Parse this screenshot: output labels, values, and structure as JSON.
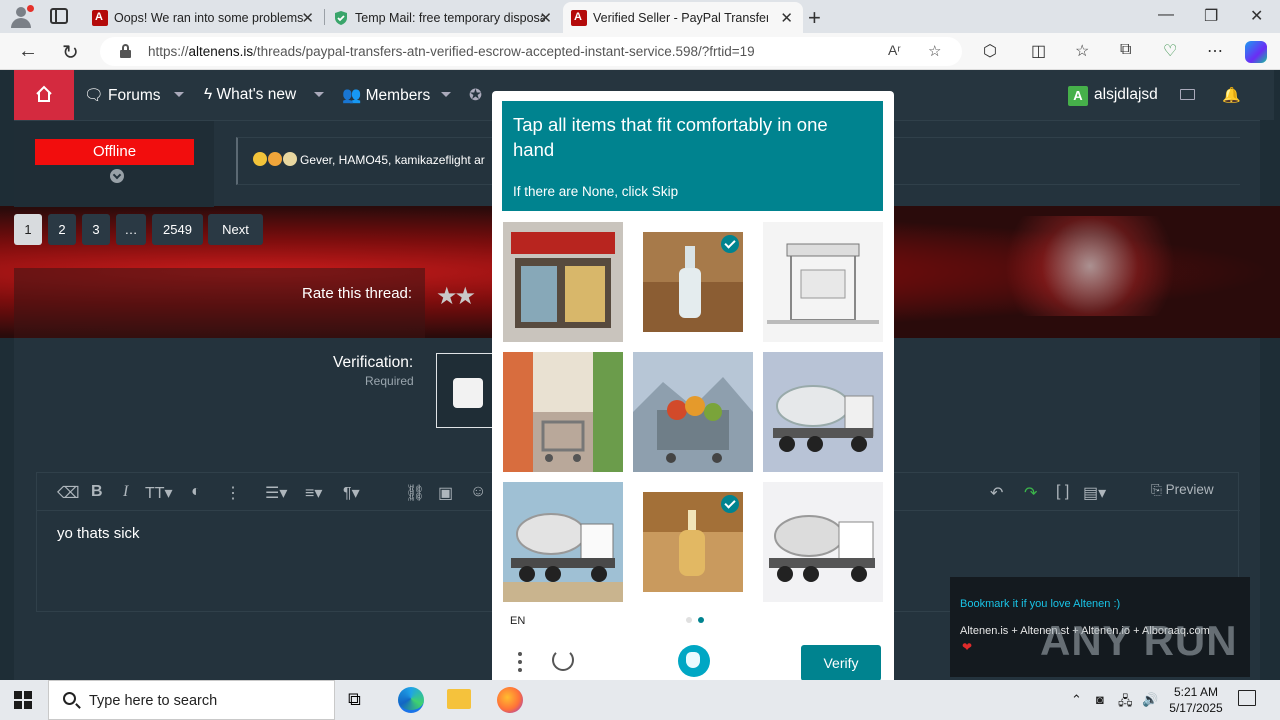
{
  "browser": {
    "tabs": [
      {
        "title": "Oops! We ran into some problems",
        "favicon": "altenen-icon"
      },
      {
        "title": "Temp Mail: free temporary disposable",
        "favicon": "shield-icon"
      },
      {
        "title": "Verified Seller - PayPal Transfers - ",
        "favicon": "altenen-icon",
        "active": true
      }
    ],
    "url_prefix": "https://",
    "url_host": "altenens.is",
    "url_path": "/threads/paypal-transfers-atn-verified-escrow-accepted-instant-service.598/?frtid=19"
  },
  "forum": {
    "nav": {
      "forums": "Forums",
      "whats_new": "What's new",
      "members": "Members",
      "username": "alsjdlajsd",
      "user_initial": "A"
    },
    "post": {
      "status": "Offline",
      "reactors": "Gever, HAMO45, kamikazeflight ar"
    },
    "pagination": [
      "1",
      "2",
      "3",
      "…",
      "2549",
      "Next"
    ],
    "rate_label": "Rate this thread:",
    "verification_label": "Verification:",
    "verification_required": "Required",
    "editor_text": "yo thats sick",
    "preview_label": "Preview",
    "bookmark_title": "Bookmark it if you love Altenen :)",
    "bookmark_sites": "Altenen.is + Altenen.st + Altenen.io + Alboraaq.com",
    "watermark": "ANY RUN"
  },
  "captcha": {
    "prompt": "Tap all items that fit comfortably in one hand",
    "sub": "If there are None, click Skip",
    "images": [
      {
        "label": "",
        "subject": "store-front",
        "selected": false
      },
      {
        "label": "",
        "subject": "glass-bottle",
        "selected": true
      },
      {
        "label": "",
        "subject": "kiosk-sketch",
        "selected": false
      },
      {
        "label": "",
        "subject": "shopping-cart-aisle",
        "selected": false
      },
      {
        "label": "",
        "subject": "shopping-cart-fruit",
        "selected": false
      },
      {
        "label": "",
        "subject": "cement-truck",
        "selected": false
      },
      {
        "label": "",
        "subject": "cement-truck",
        "selected": false
      },
      {
        "label": "",
        "subject": "oil-bottle",
        "selected": true
      },
      {
        "label": "",
        "subject": "cement-truck",
        "selected": false
      }
    ],
    "language": "EN",
    "verify_label": "Verify",
    "accent": "#00838f"
  },
  "taskbar": {
    "search_placeholder": "Type here to search",
    "time": "5:21 AM",
    "date": "5/17/2025"
  }
}
